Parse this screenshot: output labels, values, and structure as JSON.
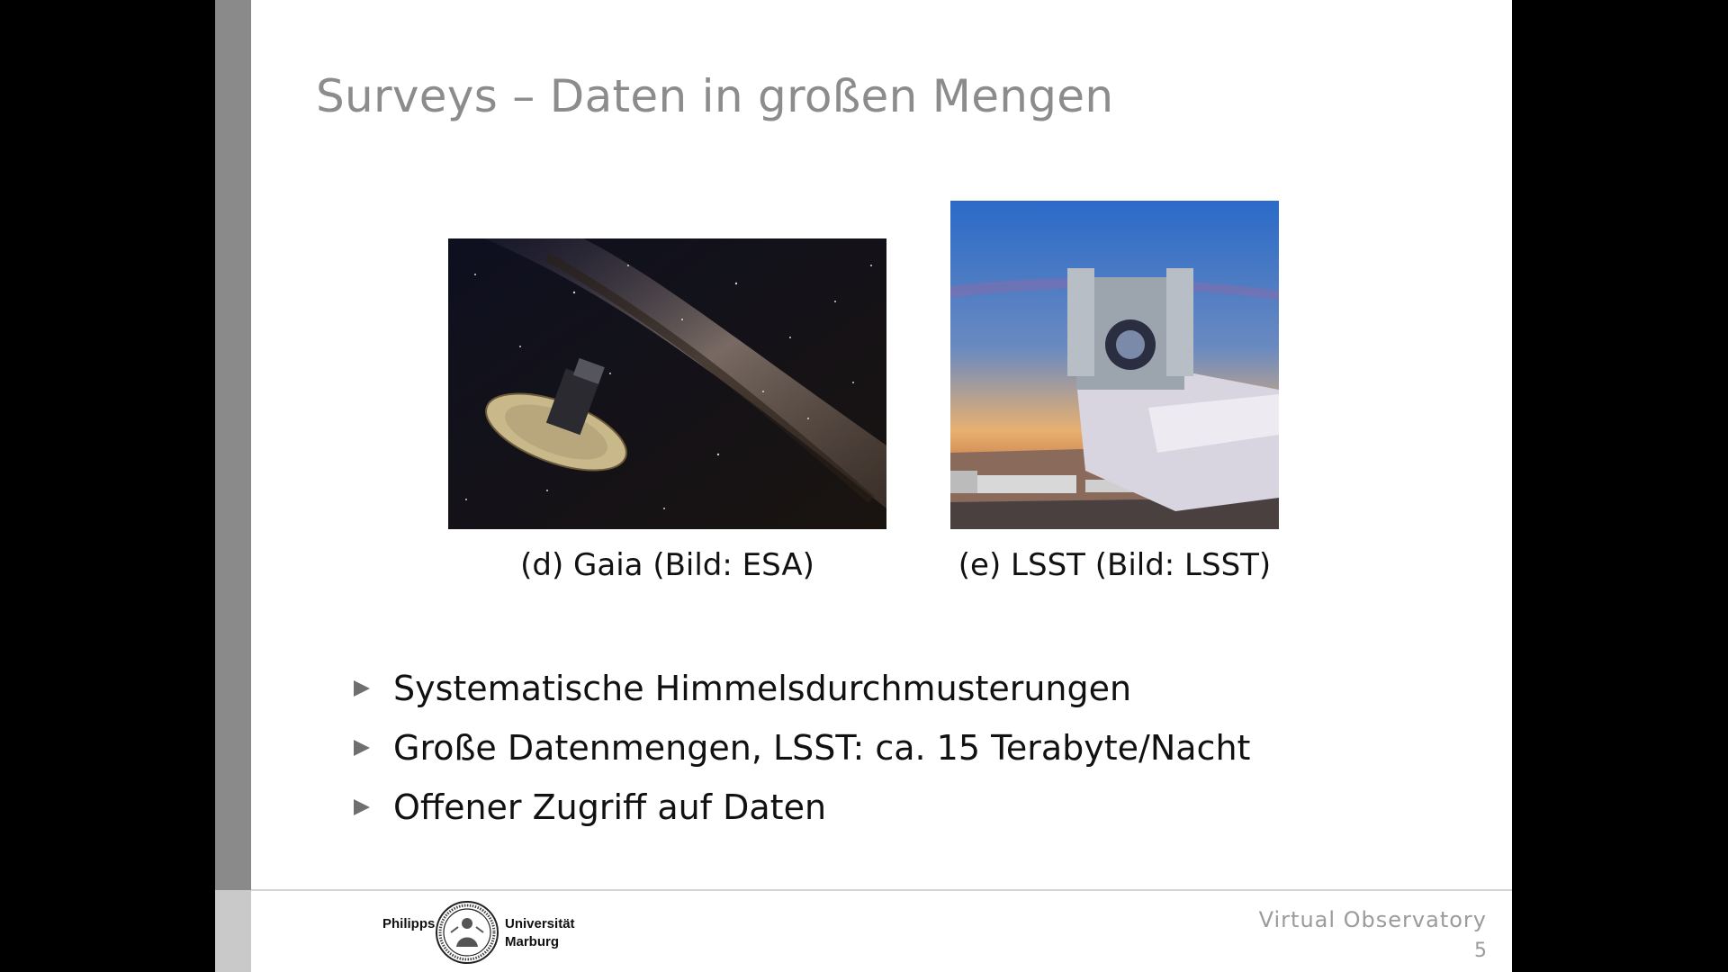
{
  "slide": {
    "title": "Surveys – Daten in großen Mengen",
    "figures": [
      {
        "caption": "(d) Gaia (Bild: ESA)",
        "image": "gaia-spacecraft-milky-way-image"
      },
      {
        "caption": "(e) LSST (Bild: LSST)",
        "image": "lsst-telescope-image"
      }
    ],
    "bullets": [
      "Systematische Himmelsdurchmusterungen",
      "Große Datenmengen, LSST: ca. 15 Terabyte/Nacht",
      "Offener Zugriff auf Daten"
    ]
  },
  "footer": {
    "logo_left": "Philipps",
    "logo_right_top": "Universität",
    "logo_right_bottom": "Marburg",
    "title": "Virtual Observatory",
    "page": "5"
  },
  "colors": {
    "title": "#8c8c8c",
    "sidebar": "#8a8a8a",
    "bullet_marker": "#6f6f6f"
  }
}
